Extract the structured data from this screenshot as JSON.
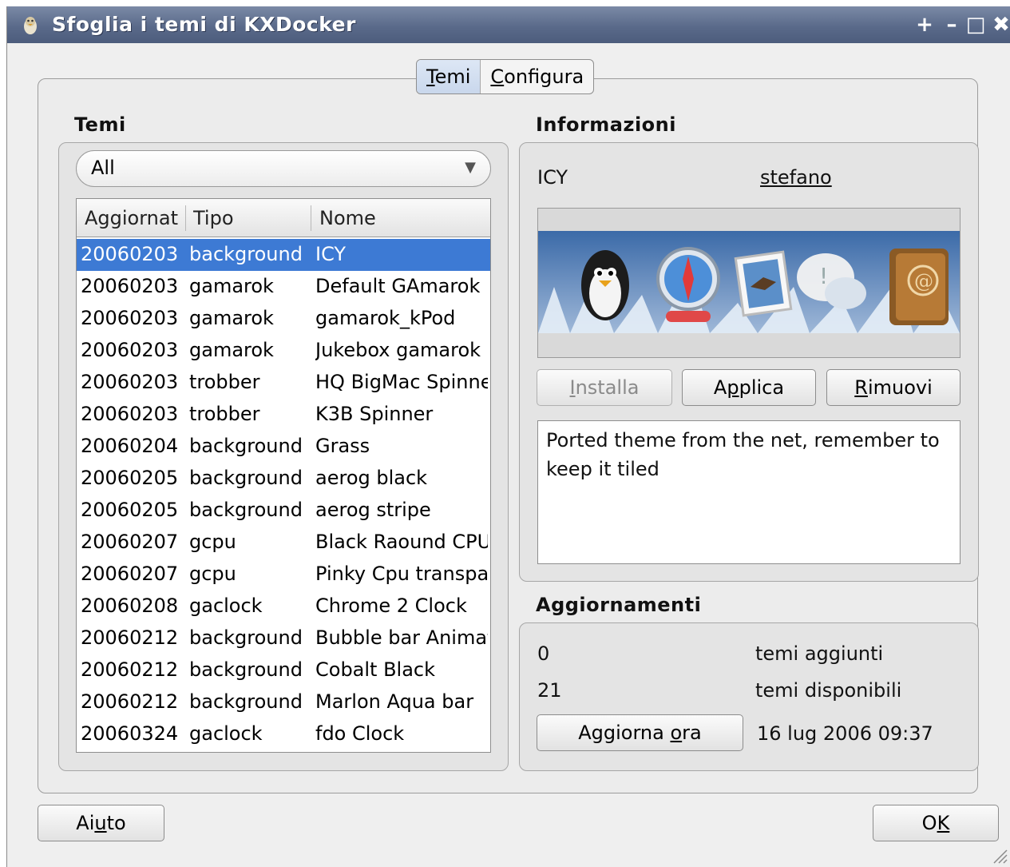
{
  "window": {
    "title": "Sfoglia i temi di KXDocker",
    "controls": [
      "+",
      "–",
      "□",
      "✖"
    ]
  },
  "tabs": [
    {
      "label_pre": "",
      "label_u": "T",
      "label_post": "emi"
    },
    {
      "label_pre": "",
      "label_u": "C",
      "label_post": "onfigura"
    }
  ],
  "themes_panel": {
    "title": "Temi",
    "filter_value": "All",
    "columns": [
      "Aggiornat",
      "Tipo",
      "Nome"
    ],
    "rows": [
      {
        "date": "20060203",
        "type": "background",
        "name": "ICY"
      },
      {
        "date": "20060203",
        "type": "gamarok",
        "name": "Default GAmarok"
      },
      {
        "date": "20060203",
        "type": "gamarok",
        "name": "gamarok_kPod"
      },
      {
        "date": "20060203",
        "type": "gamarok",
        "name": "Jukebox gamarok"
      },
      {
        "date": "20060203",
        "type": "trobber",
        "name": "HQ BigMac Spinner"
      },
      {
        "date": "20060203",
        "type": "trobber",
        "name": "K3B Spinner"
      },
      {
        "date": "20060204",
        "type": "background",
        "name": "Grass"
      },
      {
        "date": "20060205",
        "type": "background",
        "name": "aerog black"
      },
      {
        "date": "20060205",
        "type": "background",
        "name": "aerog stripe"
      },
      {
        "date": "20060207",
        "type": "gcpu",
        "name": "Black Raound CPU"
      },
      {
        "date": "20060207",
        "type": "gcpu",
        "name": "Pinky Cpu transparent"
      },
      {
        "date": "20060208",
        "type": "gaclock",
        "name": "Chrome 2 Clock"
      },
      {
        "date": "20060212",
        "type": "background",
        "name": "Bubble bar Animated"
      },
      {
        "date": "20060212",
        "type": "background",
        "name": "Cobalt Black"
      },
      {
        "date": "20060212",
        "type": "background",
        "name": "Marlon Aqua bar"
      },
      {
        "date": "20060324",
        "type": "gaclock",
        "name": "fdo Clock"
      }
    ]
  },
  "info_panel": {
    "title": "Informazioni",
    "theme_name": "ICY",
    "author": "stefano",
    "buttons": {
      "install": {
        "pre": "",
        "u": "I",
        "post": "nstalla"
      },
      "apply": {
        "pre": "A",
        "u": "p",
        "post": "plica"
      },
      "remove": {
        "pre": "",
        "u": "R",
        "post": "imuovi"
      }
    },
    "description": "Ported theme from the net, remember to keep it tiled"
  },
  "updates_panel": {
    "title": "Aggiornamenti",
    "added_count": "0",
    "added_label": "temi aggiunti",
    "available_count": "21",
    "available_label": "temi disponibili",
    "update_button": {
      "pre": "Aggiorna ",
      "u": "o",
      "post": "ra"
    },
    "last_update": "16 lug 2006 09:37"
  },
  "footer": {
    "help_button": {
      "pre": "Ai",
      "u": "u",
      "post": "to"
    },
    "ok_button": {
      "pre": "O",
      "u": "K",
      "post": ""
    }
  },
  "colors": {
    "titlebar": "#5a6a8a",
    "selection": "#3d7ad4",
    "link": "#1a27d8"
  }
}
